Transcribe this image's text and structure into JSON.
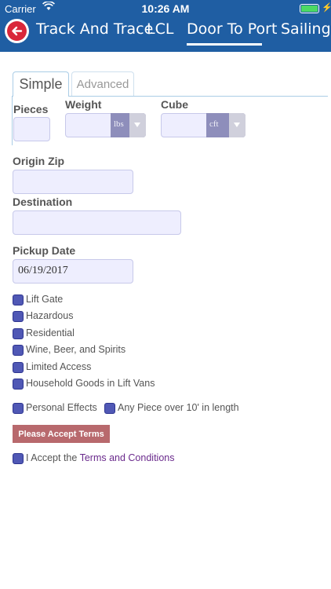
{
  "status": {
    "carrier": "Carrier",
    "time": "10:26 AM",
    "wifi_icon": "wifi-icon",
    "battery_icon": "battery-icon"
  },
  "nav": {
    "tabs": [
      {
        "label": "Track And Trace"
      },
      {
        "label": "LCL"
      },
      {
        "label": "Door To Port",
        "active": true
      },
      {
        "label": "Sailing S"
      }
    ]
  },
  "subtabs": {
    "simple": "Simple",
    "advanced": "Advanced"
  },
  "form": {
    "pieces_label": "Pieces",
    "weight_label": "Weight",
    "weight_unit": "lbs",
    "cube_label": "Cube",
    "cube_unit": "cft",
    "origin_label": "Origin Zip",
    "destination_label": "Destination",
    "pickup_label": "Pickup Date",
    "pickup_value": "06/19/2017"
  },
  "options": [
    "Lift Gate",
    "Hazardous",
    "Residential",
    "Wine, Beer, and Spirits",
    "Limited Access",
    "Household Goods in Lift Vans"
  ],
  "options_row": {
    "personal": "Personal Effects",
    "anypiece": "Any Piece over 10' in length"
  },
  "accept_button": "Please Accept Terms",
  "terms": {
    "prefix": "I Accept the ",
    "link": "Terms and Conditions"
  },
  "colors": {
    "nav_bg": "#1f5ea3",
    "back_button": "#d9263a",
    "accept_button": "#b8696d",
    "checkbox": "#5058b5",
    "link": "#6a2a8c"
  }
}
